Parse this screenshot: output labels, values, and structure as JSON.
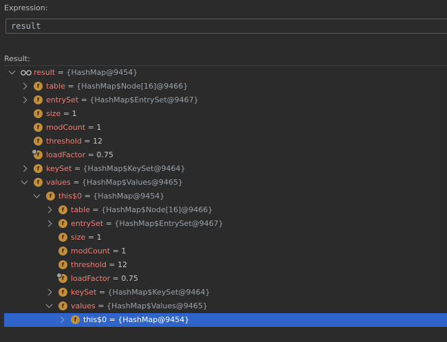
{
  "expression": {
    "label": "Expression:",
    "value": "result"
  },
  "result": {
    "label": "Result:",
    "rows": [
      {
        "depth": 0,
        "expander": "down",
        "icon": "watch",
        "name": "result",
        "eq": " = ",
        "value": "{HashMap@9454}",
        "kind": "ref"
      },
      {
        "depth": 1,
        "expander": "right",
        "icon": "field",
        "name": "table",
        "eq": " = ",
        "value": "{HashMap$Node[16]@9466}",
        "kind": "ref"
      },
      {
        "depth": 1,
        "expander": "right",
        "icon": "field",
        "name": "entrySet",
        "eq": " = ",
        "value": "{HashMap$EntrySet@9467}",
        "kind": "ref"
      },
      {
        "depth": 1,
        "expander": "none",
        "icon": "field",
        "name": "size",
        "eq": " = ",
        "value": "1",
        "kind": "num"
      },
      {
        "depth": 1,
        "expander": "none",
        "icon": "field",
        "name": "modCount",
        "eq": " = ",
        "value": "1",
        "kind": "num"
      },
      {
        "depth": 1,
        "expander": "none",
        "icon": "field",
        "name": "threshold",
        "eq": " = ",
        "value": "12",
        "kind": "num"
      },
      {
        "depth": 1,
        "expander": "none",
        "icon": "field-locked",
        "name": "loadFactor",
        "eq": " = ",
        "value": "0.75",
        "kind": "num"
      },
      {
        "depth": 1,
        "expander": "right",
        "icon": "field",
        "name": "keySet",
        "eq": " = ",
        "value": "{HashMap$KeySet@9464}",
        "kind": "ref"
      },
      {
        "depth": 1,
        "expander": "down",
        "icon": "field",
        "name": "values",
        "eq": " = ",
        "value": "{HashMap$Values@9465}",
        "kind": "ref"
      },
      {
        "depth": 2,
        "expander": "down",
        "icon": "field",
        "name": "this$0",
        "eq": " = ",
        "value": "{HashMap@9454}",
        "kind": "ref"
      },
      {
        "depth": 3,
        "expander": "right",
        "icon": "field",
        "name": "table",
        "eq": " = ",
        "value": "{HashMap$Node[16]@9466}",
        "kind": "ref"
      },
      {
        "depth": 3,
        "expander": "right",
        "icon": "field",
        "name": "entrySet",
        "eq": " = ",
        "value": "{HashMap$EntrySet@9467}",
        "kind": "ref"
      },
      {
        "depth": 3,
        "expander": "none",
        "icon": "field",
        "name": "size",
        "eq": " = ",
        "value": "1",
        "kind": "num"
      },
      {
        "depth": 3,
        "expander": "none",
        "icon": "field",
        "name": "modCount",
        "eq": " = ",
        "value": "1",
        "kind": "num"
      },
      {
        "depth": 3,
        "expander": "none",
        "icon": "field",
        "name": "threshold",
        "eq": " = ",
        "value": "12",
        "kind": "num"
      },
      {
        "depth": 3,
        "expander": "none",
        "icon": "field-locked",
        "name": "loadFactor",
        "eq": " = ",
        "value": "0.75",
        "kind": "num"
      },
      {
        "depth": 3,
        "expander": "right",
        "icon": "field",
        "name": "keySet",
        "eq": " = ",
        "value": "{HashMap$KeySet@9464}",
        "kind": "ref"
      },
      {
        "depth": 3,
        "expander": "down",
        "icon": "field",
        "name": "values",
        "eq": " = ",
        "value": "{HashMap$Values@9465}",
        "kind": "ref"
      },
      {
        "depth": 4,
        "expander": "right",
        "icon": "field",
        "name": "this$0",
        "eq": " = ",
        "value": "{HashMap@9454}",
        "kind": "ref",
        "selected": true
      }
    ]
  },
  "colors": {
    "background": "#2b2b2b",
    "selection": "#2f65ca",
    "field_name": "#ee7e74",
    "field_icon": "#c28e3a"
  }
}
